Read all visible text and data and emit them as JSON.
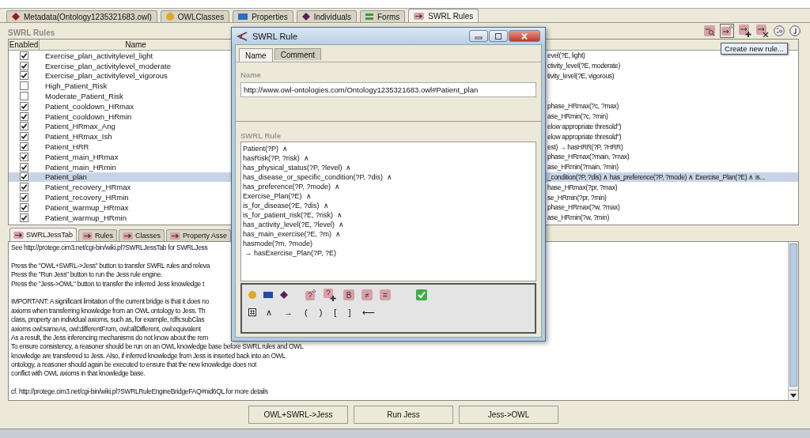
{
  "main_tabs": [
    {
      "label": "Metadata(Ontology1235321683.owl)",
      "kind": "metadata",
      "selected": false
    },
    {
      "label": "OWLClasses",
      "kind": "classes",
      "selected": false
    },
    {
      "label": "Properties",
      "kind": "properties",
      "selected": false
    },
    {
      "label": "Individuals",
      "kind": "individuals",
      "selected": false
    },
    {
      "label": "Forms",
      "kind": "forms",
      "selected": false
    },
    {
      "label": "SWRL Rules",
      "kind": "rules",
      "selected": true
    }
  ],
  "rules_panel": {
    "title": "SWRL Rules",
    "tooltip": "Create new rule...",
    "columns": [
      "Enabled",
      "Name"
    ],
    "rows": [
      {
        "enabled": true,
        "name": "Exercise_plan_activitylevel_light",
        "column_3": "evel(?E, light)",
        "selected": false
      },
      {
        "enabled": true,
        "name": "Exercise_plan_activitylevel_moderate",
        "column_3": "ctivity_level(?E, moderate)",
        "selected": false
      },
      {
        "enabled": true,
        "name": "Exercise_plan_activitylevel_vigorous",
        "column_3": "tivity_level(?E, vigorous)",
        "selected": false
      },
      {
        "enabled": false,
        "name": "High_Patient_Risk",
        "selected": false
      },
      {
        "enabled": false,
        "name": "Moderate_Patient_Risk",
        "selected": false
      },
      {
        "enabled": true,
        "name": "Patient_cooldown_HRmax",
        "column_3": "phase_HRmax(?c, ?max)",
        "selected": false
      },
      {
        "enabled": true,
        "name": "Patient_cooldown_HRmin",
        "column_3": "ase_HRmin(?c, ?min)",
        "selected": false
      },
      {
        "enabled": true,
        "name": "Patient_HRmax_Ang",
        "column_3": "elow appropriate thresold\")",
        "selected": false
      },
      {
        "enabled": true,
        "name": "Patient_HRmax_Ish",
        "column_3": "elow appropriate thresold\")",
        "selected": false
      },
      {
        "enabled": true,
        "name": "Patient_HRR",
        "column_3": "est) → hasHRR(?P, ?HRR)",
        "selected": false
      },
      {
        "enabled": true,
        "name": "Patient_main_HRmax",
        "column_3": "phase_HRmax(?main, ?max)",
        "selected": false
      },
      {
        "enabled": true,
        "name": "Patient_main_HRmin",
        "column_3": "ase_HRmin(?main, ?min)",
        "selected": false
      },
      {
        "enabled": true,
        "name": "Patient_plan",
        "column_3": "_condition(?P, ?dis) ∧ has_preference(?P, ?mode) ∧ Exercise_Plan(?E) ∧ is...",
        "selected": true
      },
      {
        "enabled": true,
        "name": "Patient_recovery_HRmax",
        "column_3": "hase_HRmax(?pr, ?max)",
        "selected": false
      },
      {
        "enabled": true,
        "name": "Patient_recovery_HRmin",
        "column_3": "se_HRmin(?pr, ?min)",
        "selected": false
      },
      {
        "enabled": true,
        "name": "Patient_warmup_HRmax",
        "column_3": "phase_HRmax(?w, ?max)",
        "selected": false
      },
      {
        "enabled": true,
        "name": "Patient_warmup_HRmin",
        "column_3": "ase_HRmin(?w, ?min)",
        "selected": false
      }
    ]
  },
  "bottom_tabs": [
    {
      "label": "SWRLJessTab",
      "selected": true
    },
    {
      "label": "Rules",
      "selected": false
    },
    {
      "label": "Classes",
      "selected": false
    },
    {
      "label": "Property Asse",
      "selected": false
    }
  ],
  "log_paragraphs": [
    [
      "See http://protege.cim3.net/cgi-bin/wiki.pl?SWRLJessTab for SWRLJess"
    ],
    [
      "Press the \"OWL+SWRL->Jess\" button to transfer SWRL rules and releva",
      "Press the \"Run Jess\" button to run the Jess rule engine.",
      "Press the \"Jess->OWL\" button to transfer the inferred Jess knowledge t"
    ],
    [
      "IMPORTANT: A significant limitation of the current bridge is that it does no",
      "axioms when transferring knowledge from an OWL ontology to Jess. Th",
      "class, property an individual axioms, such as, for example, rdfs:subClas",
      "axioms owl:sameAs, owl:differentFrom, owl:allDifferent, owl:equivalent",
      "As a result, the Jess inferencing mechanisms do not know about the rem",
      "To ensure consistency, a reasoner should be run on an OWL knowledge base before SWRL rules and OWL",
      "knowledge are transferred to Jess. Also, if inferred knowledge from Jess is inserted back into an OWL",
      "ontology, a reasoner should again be executed to ensure that the new knowledge does not",
      "conflict with OWL axioms in that knowledge base."
    ],
    [
      "cf. http://protege.cim3.net/cgi-bin/wiki.pl?SWRLRuleEngineBridgeFAQ#nid6QL for more details"
    ]
  ],
  "buttons": [
    "OWL+SWRL->Jess",
    "Run Jess",
    "Jess->OWL"
  ],
  "dialog": {
    "title": "SWRL Rule",
    "tabs": [
      {
        "label": "Name",
        "selected": true
      },
      {
        "label": "Comment",
        "selected": false
      }
    ],
    "name_label": "Name",
    "name_value": "http://www.owl-ontologies.com/Ontology1235321683.owl#Patient_plan",
    "rule_label": "SWRL Rule",
    "rule_lines": [
      "Patient(?P)  ∧",
      "hasRisk(?P, ?risk)  ∧",
      "has_physical_status(?P, ?level)  ∧",
      "has_disease_or_specific_condition(?P, ?dis)  ∧",
      "has_preference(?P, ?mode)  ∧",
      "Exercise_Plan(?E)  ∧",
      "is_for_disease(?E, ?dis)  ∧",
      "is_for_patient_risk(?E, ?risk)  ∧",
      "has_activity_level(?E, ?level)  ∧",
      "has_main_exercise(?E, ?m)  ∧",
      "hasmode(?m, ?mode)",
      " → hasExercise_Plan(?P, ?E)"
    ],
    "letter_buttons": [
      "B",
      "≠",
      "="
    ],
    "symbols": [
      "∧",
      "→",
      "(",
      ")",
      "[",
      "]",
      "⟵"
    ]
  }
}
